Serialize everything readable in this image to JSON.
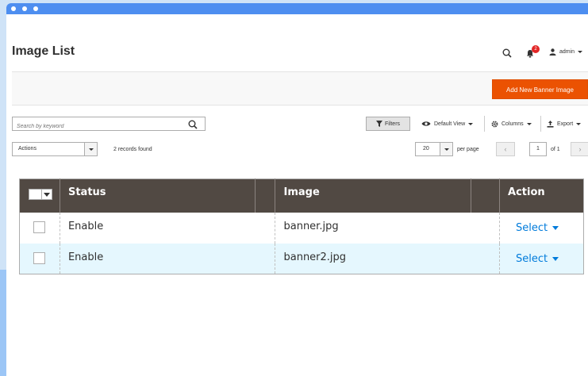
{
  "header": {
    "title": "Image List",
    "notification_count": "2",
    "user": "admin"
  },
  "actionbar": {
    "add_button": "Add New Banner Image"
  },
  "toolbar": {
    "search_placeholder": "Search by keyword",
    "filters": "Filters",
    "default_view": "Default View",
    "columns": "Columns",
    "export": "Export",
    "actions": "Actions",
    "records_found": "2 records found",
    "per_page_value": "20",
    "per_page_label": "per page",
    "page_current": "1",
    "page_of": "of 1"
  },
  "grid": {
    "columns": [
      "Status",
      "Image",
      "Action"
    ],
    "rows": [
      {
        "status": "Enable",
        "image": "banner.jpg",
        "action": "Select"
      },
      {
        "status": "Enable",
        "image": "banner2.jpg",
        "action": "Select"
      }
    ]
  },
  "colors": {
    "accent": "#eb5202",
    "header_bg": "#514943",
    "link": "#007bdb",
    "titlebar": "#4d8ef0"
  }
}
